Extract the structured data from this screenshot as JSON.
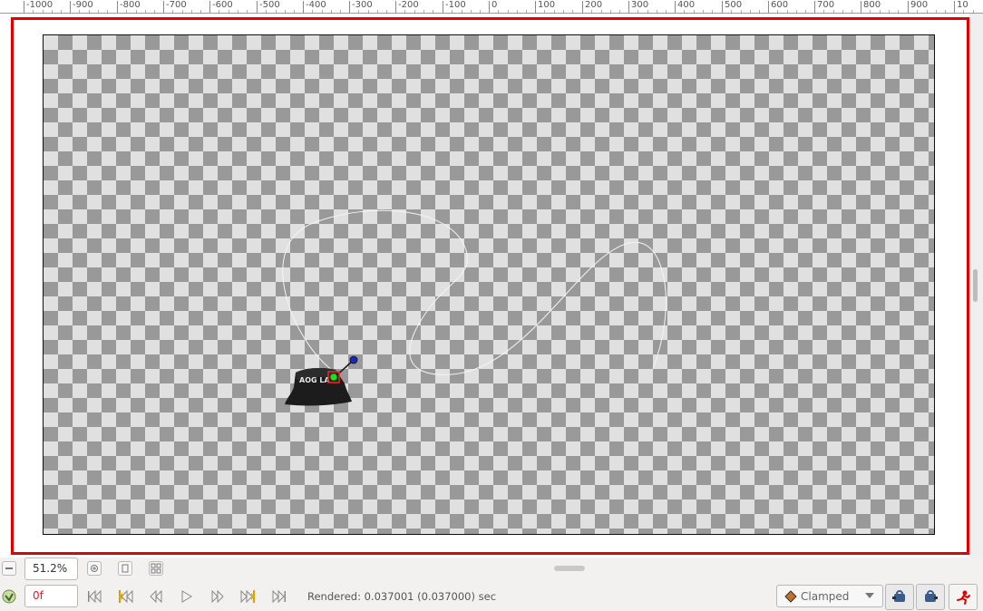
{
  "ruler": {
    "labels": [
      "-1000",
      "-900",
      "-800",
      "-700",
      "-600",
      "-500",
      "-400",
      "-300",
      "-200",
      "-100",
      "0",
      "100",
      "200",
      "300",
      "400",
      "500",
      "600",
      "700",
      "800",
      "900",
      "10"
    ]
  },
  "zoom": {
    "value": "51.2%"
  },
  "time": {
    "value": "0f"
  },
  "status": {
    "rendered": "Rendered: 0.037001 (0.037000) sec"
  },
  "interpolation": {
    "label": "Clamped"
  },
  "colors": {
    "frame_red": "#e00000",
    "handle_green": "#22dd22",
    "handle_blue": "#1a2aa8",
    "interp_orange": "#c0722a"
  },
  "icons": {
    "zoom_out": "zoom-out-icon",
    "zoom_in": "zoom-in-icon",
    "zoom_fit": "zoom-fit-icon",
    "zoom_extents": "zoom-extents-icon",
    "keyframe_lock": "keyframe-lock-icon",
    "seek_begin": "seek-to-begin-icon",
    "seek_prev_keyframe": "seek-prev-keyframe-icon",
    "seek_prev_frame": "seek-prev-frame-icon",
    "play": "play-icon",
    "seek_next_frame": "seek-next-frame-icon",
    "seek_next_keyframe": "seek-next-keyframe-icon",
    "seek_end": "seek-to-end-icon",
    "past_keyframes": "past-keyframes-lock-icon",
    "future_keyframes": "future-keyframes-lock-icon",
    "animation_mode": "animation-mode-icon"
  }
}
